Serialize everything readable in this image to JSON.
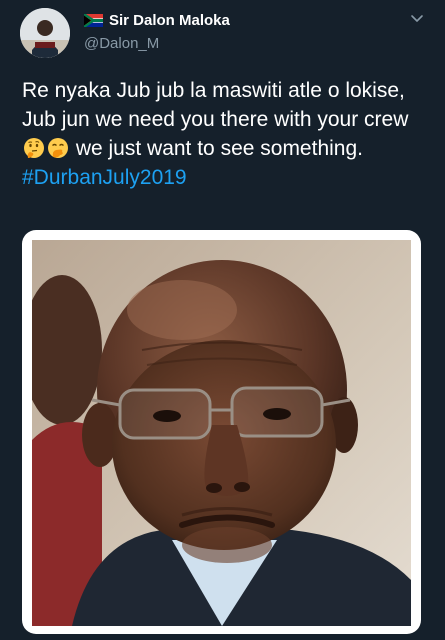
{
  "author": {
    "display_name": "Sir Dalon Maloka",
    "handle": "@Dalon_M",
    "flag_icon": "south-africa-flag-icon",
    "avatar_icon": "profile-avatar"
  },
  "tweet": {
    "text_before_emoji": "Re nyaka Jub jub la maswiti atle o lokise, Jub jun we need you there with your crew",
    "emojis": [
      "thinking-face-emoji",
      "face-with-hand-over-mouth-emoji"
    ],
    "text_after_emoji": " we just want to see something. ",
    "hashtag": "#DurbanJuly2019"
  },
  "media": {
    "type": "photo",
    "subject": "man-with-glasses-photo"
  },
  "colors": {
    "background": "#15202b",
    "text": "#ffffff",
    "secondary_text": "#8899a6",
    "link": "#1da1f2"
  }
}
